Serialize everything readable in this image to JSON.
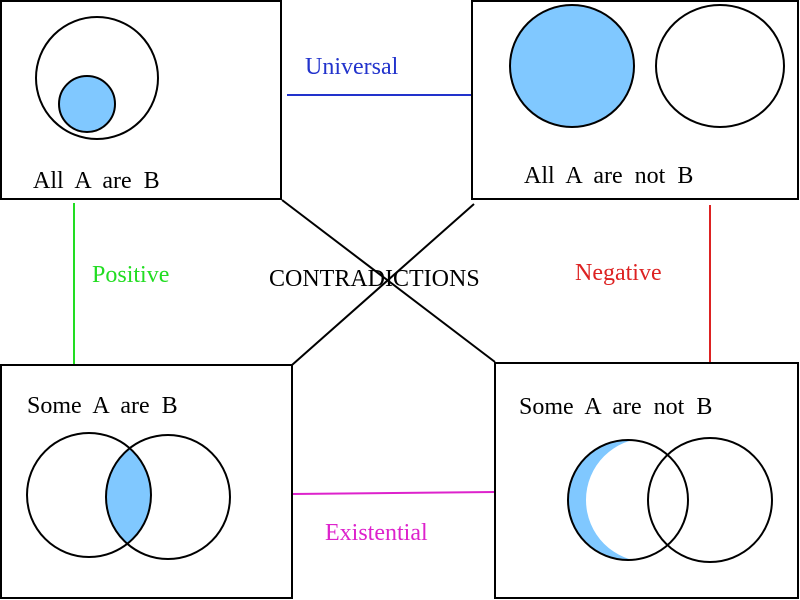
{
  "colors": {
    "fill": "#80c8ff",
    "stroke": "#000000",
    "universal": "#2233cc",
    "positive": "#22dd22",
    "negative": "#dd2222",
    "existential": "#dd22cc"
  },
  "boxes": {
    "all_a_are_b": "All  A  are  B",
    "all_a_are_not_b": "All  A  are  not  B",
    "some_a_are_b": "Some  A  are  B",
    "some_a_are_not_b": "Some  A  are  not  B"
  },
  "relations": {
    "universal": "Universal",
    "positive": "Positive",
    "negative": "Negative",
    "existential": "Existential",
    "contradictions": "CONTRADICTIONS"
  }
}
